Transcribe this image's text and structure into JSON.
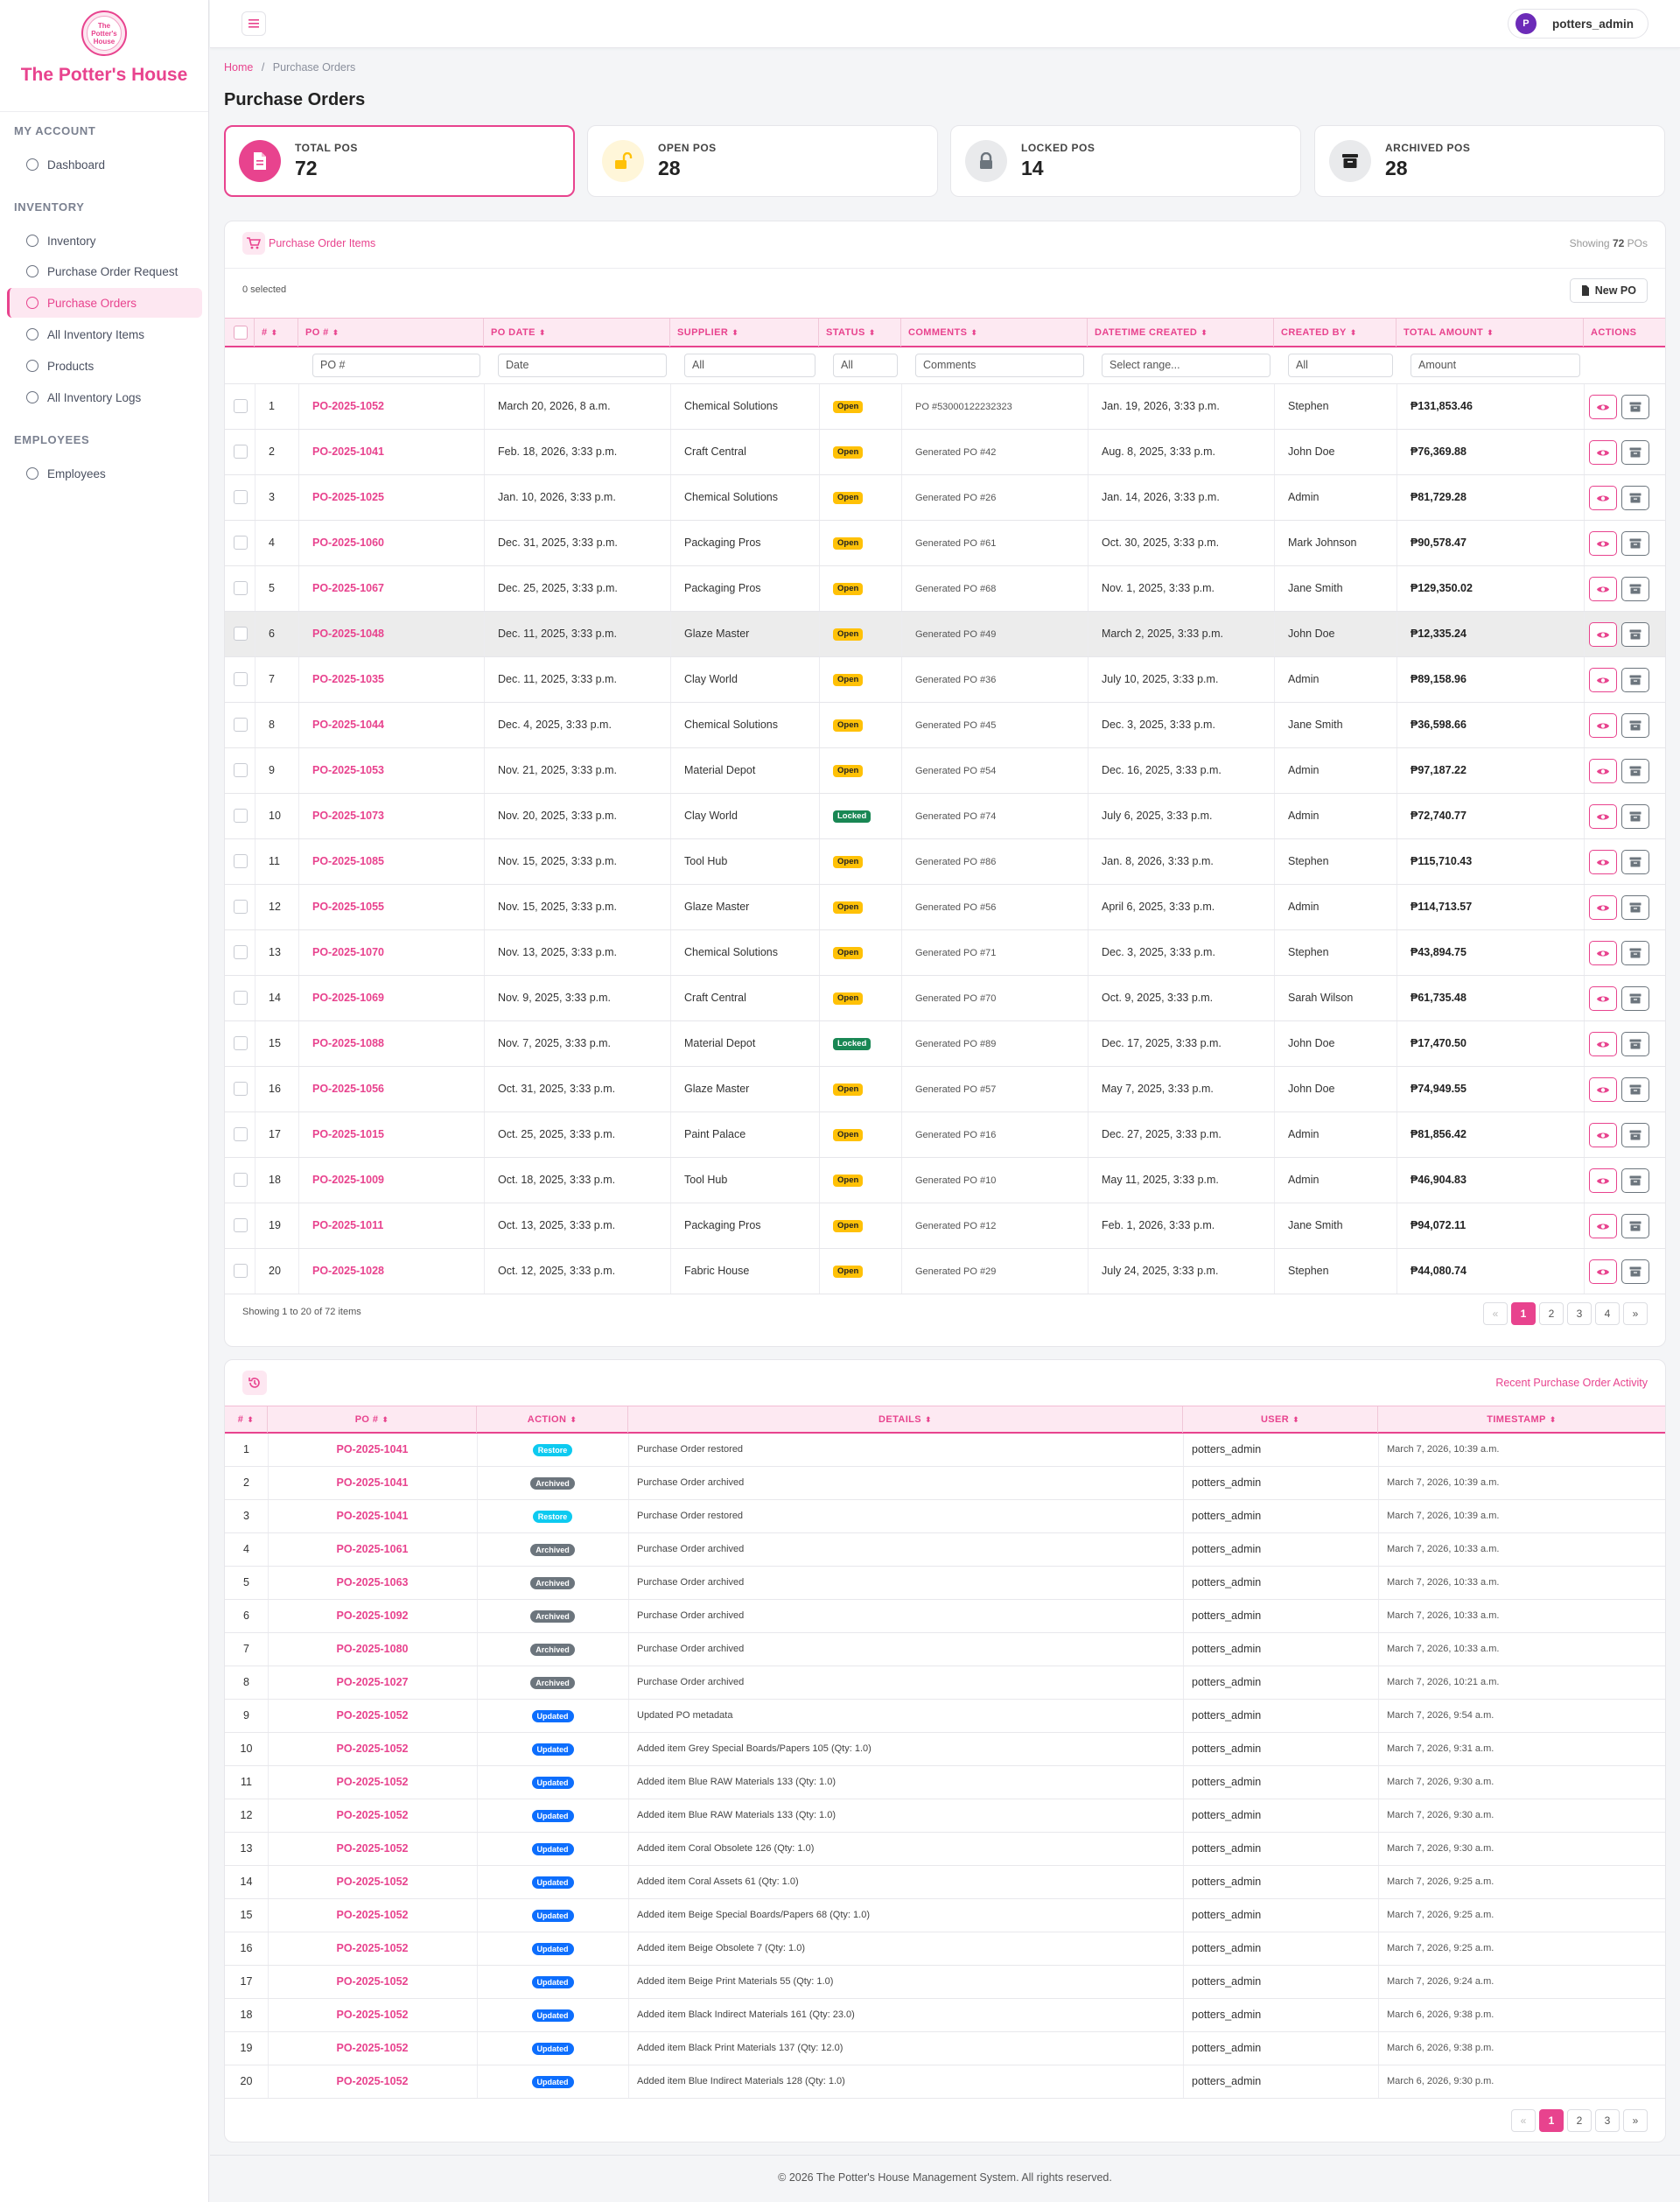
{
  "brand": {
    "name": "The Potter's House",
    "logo_text": "The Potter's House"
  },
  "sidebar": {
    "sections": [
      {
        "title": "MY ACCOUNT",
        "items": [
          {
            "label": "Dashboard"
          }
        ]
      },
      {
        "title": "INVENTORY",
        "items": [
          {
            "label": "Inventory"
          },
          {
            "label": "Purchase Order Request"
          },
          {
            "label": "Purchase Orders",
            "active": true
          },
          {
            "label": "All Inventory Items"
          },
          {
            "label": "Products"
          },
          {
            "label": "All Inventory Logs"
          }
        ]
      },
      {
        "title": "EMPLOYEES",
        "items": [
          {
            "label": "Employees"
          }
        ]
      }
    ]
  },
  "topbar": {
    "user_initial": "P",
    "username": "potters_admin",
    "menu_icon": "hamburger-icon"
  },
  "breadcrumb": {
    "home": "Home",
    "separator": "/",
    "current": "Purchase Orders"
  },
  "page_title": "Purchase Orders",
  "stats": [
    {
      "label": "TOTAL POS",
      "value": "72",
      "icon": "document-icon",
      "color": "#e8438e"
    },
    {
      "label": "OPEN POS",
      "value": "28",
      "icon": "unlock-icon",
      "color": "#ffc107"
    },
    {
      "label": "LOCKED POS",
      "value": "14",
      "icon": "lock-icon",
      "color": "#6c757d"
    },
    {
      "label": "ARCHIVED POS",
      "value": "28",
      "icon": "archive-icon",
      "color": "#222222"
    }
  ],
  "po_card": {
    "title": "Purchase Order Items",
    "showing_prefix": "Showing",
    "showing_count": "72",
    "showing_suffix": "POs",
    "selected_text": "0 selected",
    "new_button": "New PO",
    "columns": [
      "#",
      "PO #",
      "PO DATE",
      "SUPPLIER",
      "STATUS",
      "COMMENTS",
      "DATETIME CREATED",
      "CREATED BY",
      "TOTAL AMOUNT",
      "ACTIONS"
    ],
    "filters": {
      "po": "PO #",
      "date": "Date",
      "supplier": "All",
      "status": "All",
      "comments": "Comments",
      "created": "Select range...",
      "created_by": "All",
      "amount": "Amount"
    },
    "rows": [
      {
        "n": "1",
        "po": "PO-2025-1052",
        "date": "March 20, 2026, 8 a.m.",
        "supplier": "Chemical Solutions",
        "status": "Open",
        "comments": "PO #53000122232323",
        "created": "Jan. 19, 2026, 3:33 p.m.",
        "by": "Stephen",
        "amount": "₱131,853.46"
      },
      {
        "n": "2",
        "po": "PO-2025-1041",
        "date": "Feb. 18, 2026, 3:33 p.m.",
        "supplier": "Craft Central",
        "status": "Open",
        "comments": "Generated PO #42",
        "created": "Aug. 8, 2025, 3:33 p.m.",
        "by": "John Doe",
        "amount": "₱76,369.88"
      },
      {
        "n": "3",
        "po": "PO-2025-1025",
        "date": "Jan. 10, 2026, 3:33 p.m.",
        "supplier": "Chemical Solutions",
        "status": "Open",
        "comments": "Generated PO #26",
        "created": "Jan. 14, 2026, 3:33 p.m.",
        "by": "Admin",
        "amount": "₱81,729.28"
      },
      {
        "n": "4",
        "po": "PO-2025-1060",
        "date": "Dec. 31, 2025, 3:33 p.m.",
        "supplier": "Packaging Pros",
        "status": "Open",
        "comments": "Generated PO #61",
        "created": "Oct. 30, 2025, 3:33 p.m.",
        "by": "Mark Johnson",
        "amount": "₱90,578.47"
      },
      {
        "n": "5",
        "po": "PO-2025-1067",
        "date": "Dec. 25, 2025, 3:33 p.m.",
        "supplier": "Packaging Pros",
        "status": "Open",
        "comments": "Generated PO #68",
        "created": "Nov. 1, 2025, 3:33 p.m.",
        "by": "Jane Smith",
        "amount": "₱129,350.02"
      },
      {
        "n": "6",
        "po": "PO-2025-1048",
        "date": "Dec. 11, 2025, 3:33 p.m.",
        "supplier": "Glaze Master",
        "status": "Open",
        "comments": "Generated PO #49",
        "created": "March 2, 2025, 3:33 p.m.",
        "by": "John Doe",
        "amount": "₱12,335.24",
        "highlight": true
      },
      {
        "n": "7",
        "po": "PO-2025-1035",
        "date": "Dec. 11, 2025, 3:33 p.m.",
        "supplier": "Clay World",
        "status": "Open",
        "comments": "Generated PO #36",
        "created": "July 10, 2025, 3:33 p.m.",
        "by": "Admin",
        "amount": "₱89,158.96"
      },
      {
        "n": "8",
        "po": "PO-2025-1044",
        "date": "Dec. 4, 2025, 3:33 p.m.",
        "supplier": "Chemical Solutions",
        "status": "Open",
        "comments": "Generated PO #45",
        "created": "Dec. 3, 2025, 3:33 p.m.",
        "by": "Jane Smith",
        "amount": "₱36,598.66"
      },
      {
        "n": "9",
        "po": "PO-2025-1053",
        "date": "Nov. 21, 2025, 3:33 p.m.",
        "supplier": "Material Depot",
        "status": "Open",
        "comments": "Generated PO #54",
        "created": "Dec. 16, 2025, 3:33 p.m.",
        "by": "Admin",
        "amount": "₱97,187.22"
      },
      {
        "n": "10",
        "po": "PO-2025-1073",
        "date": "Nov. 20, 2025, 3:33 p.m.",
        "supplier": "Clay World",
        "status": "Locked",
        "comments": "Generated PO #74",
        "created": "July 6, 2025, 3:33 p.m.",
        "by": "Admin",
        "amount": "₱72,740.77"
      },
      {
        "n": "11",
        "po": "PO-2025-1085",
        "date": "Nov. 15, 2025, 3:33 p.m.",
        "supplier": "Tool Hub",
        "status": "Open",
        "comments": "Generated PO #86",
        "created": "Jan. 8, 2026, 3:33 p.m.",
        "by": "Stephen",
        "amount": "₱115,710.43"
      },
      {
        "n": "12",
        "po": "PO-2025-1055",
        "date": "Nov. 15, 2025, 3:33 p.m.",
        "supplier": "Glaze Master",
        "status": "Open",
        "comments": "Generated PO #56",
        "created": "April 6, 2025, 3:33 p.m.",
        "by": "Admin",
        "amount": "₱114,713.57"
      },
      {
        "n": "13",
        "po": "PO-2025-1070",
        "date": "Nov. 13, 2025, 3:33 p.m.",
        "supplier": "Chemical Solutions",
        "status": "Open",
        "comments": "Generated PO #71",
        "created": "Dec. 3, 2025, 3:33 p.m.",
        "by": "Stephen",
        "amount": "₱43,894.75"
      },
      {
        "n": "14",
        "po": "PO-2025-1069",
        "date": "Nov. 9, 2025, 3:33 p.m.",
        "supplier": "Craft Central",
        "status": "Open",
        "comments": "Generated PO #70",
        "created": "Oct. 9, 2025, 3:33 p.m.",
        "by": "Sarah Wilson",
        "amount": "₱61,735.48"
      },
      {
        "n": "15",
        "po": "PO-2025-1088",
        "date": "Nov. 7, 2025, 3:33 p.m.",
        "supplier": "Material Depot",
        "status": "Locked",
        "comments": "Generated PO #89",
        "created": "Dec. 17, 2025, 3:33 p.m.",
        "by": "John Doe",
        "amount": "₱17,470.50"
      },
      {
        "n": "16",
        "po": "PO-2025-1056",
        "date": "Oct. 31, 2025, 3:33 p.m.",
        "supplier": "Glaze Master",
        "status": "Open",
        "comments": "Generated PO #57",
        "created": "May 7, 2025, 3:33 p.m.",
        "by": "John Doe",
        "amount": "₱74,949.55"
      },
      {
        "n": "17",
        "po": "PO-2025-1015",
        "date": "Oct. 25, 2025, 3:33 p.m.",
        "supplier": "Paint Palace",
        "status": "Open",
        "comments": "Generated PO #16",
        "created": "Dec. 27, 2025, 3:33 p.m.",
        "by": "Admin",
        "amount": "₱81,856.42"
      },
      {
        "n": "18",
        "po": "PO-2025-1009",
        "date": "Oct. 18, 2025, 3:33 p.m.",
        "supplier": "Tool Hub",
        "status": "Open",
        "comments": "Generated PO #10",
        "created": "May 11, 2025, 3:33 p.m.",
        "by": "Admin",
        "amount": "₱46,904.83"
      },
      {
        "n": "19",
        "po": "PO-2025-1011",
        "date": "Oct. 13, 2025, 3:33 p.m.",
        "supplier": "Packaging Pros",
        "status": "Open",
        "comments": "Generated PO #12",
        "created": "Feb. 1, 2026, 3:33 p.m.",
        "by": "Jane Smith",
        "amount": "₱94,072.11"
      },
      {
        "n": "20",
        "po": "PO-2025-1028",
        "date": "Oct. 12, 2025, 3:33 p.m.",
        "supplier": "Fabric House",
        "status": "Open",
        "comments": "Generated PO #29",
        "created": "July 24, 2025, 3:33 p.m.",
        "by": "Stephen",
        "amount": "₱44,080.74"
      }
    ],
    "footer_text": "Showing 1 to 20 of 72 items",
    "pagination": [
      "«",
      "1",
      "2",
      "3",
      "4",
      "»"
    ],
    "current_page": "1"
  },
  "activity_card": {
    "title": "Recent Purchase Order Activity",
    "icon": "history-icon",
    "columns": [
      "#",
      "PO #",
      "ACTION",
      "DETAILS",
      "USER",
      "TIMESTAMP"
    ],
    "rows": [
      {
        "n": "1",
        "po": "PO-2025-1041",
        "action": "Restore",
        "details": "Purchase Order restored",
        "user": "potters_admin",
        "ts": "March 7, 2026, 10:39 a.m."
      },
      {
        "n": "2",
        "po": "PO-2025-1041",
        "action": "Archived",
        "details": "Purchase Order archived",
        "user": "potters_admin",
        "ts": "March 7, 2026, 10:39 a.m."
      },
      {
        "n": "3",
        "po": "PO-2025-1041",
        "action": "Restore",
        "details": "Purchase Order restored",
        "user": "potters_admin",
        "ts": "March 7, 2026, 10:39 a.m."
      },
      {
        "n": "4",
        "po": "PO-2025-1061",
        "action": "Archived",
        "details": "Purchase Order archived",
        "user": "potters_admin",
        "ts": "March 7, 2026, 10:33 a.m."
      },
      {
        "n": "5",
        "po": "PO-2025-1063",
        "action": "Archived",
        "details": "Purchase Order archived",
        "user": "potters_admin",
        "ts": "March 7, 2026, 10:33 a.m."
      },
      {
        "n": "6",
        "po": "PO-2025-1092",
        "action": "Archived",
        "details": "Purchase Order archived",
        "user": "potters_admin",
        "ts": "March 7, 2026, 10:33 a.m."
      },
      {
        "n": "7",
        "po": "PO-2025-1080",
        "action": "Archived",
        "details": "Purchase Order archived",
        "user": "potters_admin",
        "ts": "March 7, 2026, 10:33 a.m."
      },
      {
        "n": "8",
        "po": "PO-2025-1027",
        "action": "Archived",
        "details": "Purchase Order archived",
        "user": "potters_admin",
        "ts": "March 7, 2026, 10:21 a.m."
      },
      {
        "n": "9",
        "po": "PO-2025-1052",
        "action": "Updated",
        "details": "Updated PO metadata",
        "user": "potters_admin",
        "ts": "March 7, 2026, 9:54 a.m."
      },
      {
        "n": "10",
        "po": "PO-2025-1052",
        "action": "Updated",
        "details": "Added item Grey Special Boards/Papers 105 (Qty: 1.0)",
        "user": "potters_admin",
        "ts": "March 7, 2026, 9:31 a.m."
      },
      {
        "n": "11",
        "po": "PO-2025-1052",
        "action": "Updated",
        "details": "Added item Blue RAW Materials 133 (Qty: 1.0)",
        "user": "potters_admin",
        "ts": "March 7, 2026, 9:30 a.m."
      },
      {
        "n": "12",
        "po": "PO-2025-1052",
        "action": "Updated",
        "details": "Added item Blue RAW Materials 133 (Qty: 1.0)",
        "user": "potters_admin",
        "ts": "March 7, 2026, 9:30 a.m."
      },
      {
        "n": "13",
        "po": "PO-2025-1052",
        "action": "Updated",
        "details": "Added item Coral Obsolete 126 (Qty: 1.0)",
        "user": "potters_admin",
        "ts": "March 7, 2026, 9:30 a.m."
      },
      {
        "n": "14",
        "po": "PO-2025-1052",
        "action": "Updated",
        "details": "Added item Coral Assets 61 (Qty: 1.0)",
        "user": "potters_admin",
        "ts": "March 7, 2026, 9:25 a.m."
      },
      {
        "n": "15",
        "po": "PO-2025-1052",
        "action": "Updated",
        "details": "Added item Beige Special Boards/Papers 68 (Qty: 1.0)",
        "user": "potters_admin",
        "ts": "March 7, 2026, 9:25 a.m."
      },
      {
        "n": "16",
        "po": "PO-2025-1052",
        "action": "Updated",
        "details": "Added item Beige Obsolete 7 (Qty: 1.0)",
        "user": "potters_admin",
        "ts": "March 7, 2026, 9:25 a.m."
      },
      {
        "n": "17",
        "po": "PO-2025-1052",
        "action": "Updated",
        "details": "Added item Beige Print Materials 55 (Qty: 1.0)",
        "user": "potters_admin",
        "ts": "March 7, 2026, 9:24 a.m."
      },
      {
        "n": "18",
        "po": "PO-2025-1052",
        "action": "Updated",
        "details": "Added item Black Indirect Materials 161 (Qty: 23.0)",
        "user": "potters_admin",
        "ts": "March 6, 2026, 9:38 p.m."
      },
      {
        "n": "19",
        "po": "PO-2025-1052",
        "action": "Updated",
        "details": "Added item Black Print Materials 137 (Qty: 12.0)",
        "user": "potters_admin",
        "ts": "March 6, 2026, 9:38 p.m."
      },
      {
        "n": "20",
        "po": "PO-2025-1052",
        "action": "Updated",
        "details": "Added item Blue Indirect Materials 128 (Qty: 1.0)",
        "user": "potters_admin",
        "ts": "March 6, 2026, 9:30 p.m."
      }
    ],
    "pagination": [
      "«",
      "1",
      "2",
      "3",
      "»"
    ],
    "current_page": "1"
  },
  "footer": "© 2026 The Potter's House Management System. All rights reserved."
}
